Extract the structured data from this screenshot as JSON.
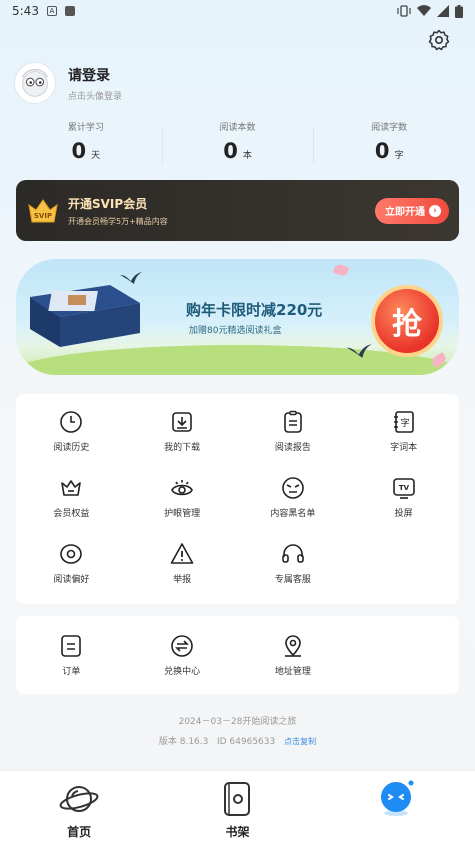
{
  "status_bar": {
    "time": "5:43",
    "app_icon_letter": "A"
  },
  "profile": {
    "title": "请登录",
    "subtitle": "点击头像登录"
  },
  "stats": [
    {
      "label": "累计学习",
      "value": "0",
      "unit": "天"
    },
    {
      "label": "阅读本数",
      "value": "0",
      "unit": "本"
    },
    {
      "label": "阅读字数",
      "value": "0",
      "unit": "字"
    }
  ],
  "svip": {
    "badge": "SVIP",
    "title": "开通SVIP会员",
    "subtitle": "开通会员畅学5万+精品内容",
    "button": "立即开通"
  },
  "banner": {
    "title": "购年卡限时减220元",
    "subtitle": "加赠80元精选阅读礼盒",
    "grab": "抢"
  },
  "menu1": [
    {
      "label": "阅读历史",
      "icon": "clock-icon"
    },
    {
      "label": "我的下载",
      "icon": "download-icon"
    },
    {
      "label": "阅读报告",
      "icon": "report-icon"
    },
    {
      "label": "字词本",
      "icon": "word-book-icon"
    },
    {
      "label": "会员权益",
      "icon": "crown-icon"
    },
    {
      "label": "护眼管理",
      "icon": "eye-icon"
    },
    {
      "label": "内容黑名单",
      "icon": "blacklist-icon"
    },
    {
      "label": "投屏",
      "icon": "tv-icon"
    },
    {
      "label": "阅读偏好",
      "icon": "preference-icon"
    },
    {
      "label": "举报",
      "icon": "warning-icon"
    },
    {
      "label": "专属客服",
      "icon": "headset-icon"
    }
  ],
  "menu2": [
    {
      "label": "订单",
      "icon": "order-icon"
    },
    {
      "label": "兑换中心",
      "icon": "exchange-icon"
    },
    {
      "label": "地址管理",
      "icon": "location-icon"
    }
  ],
  "footer": {
    "start": "2024－03－28开始阅读之旅",
    "version": "版本 8.16.3",
    "id": "ID 64965633",
    "copy": "点击复制"
  },
  "tabs": [
    {
      "label": "首页",
      "icon": "planet-icon"
    },
    {
      "label": "书架",
      "icon": "bookshelf-icon"
    },
    {
      "label": "",
      "icon": "mascot-icon"
    }
  ],
  "colors": {
    "accent": "#f04b3f",
    "svip_bg": "#2c2a27",
    "link": "#3a8ee6"
  }
}
